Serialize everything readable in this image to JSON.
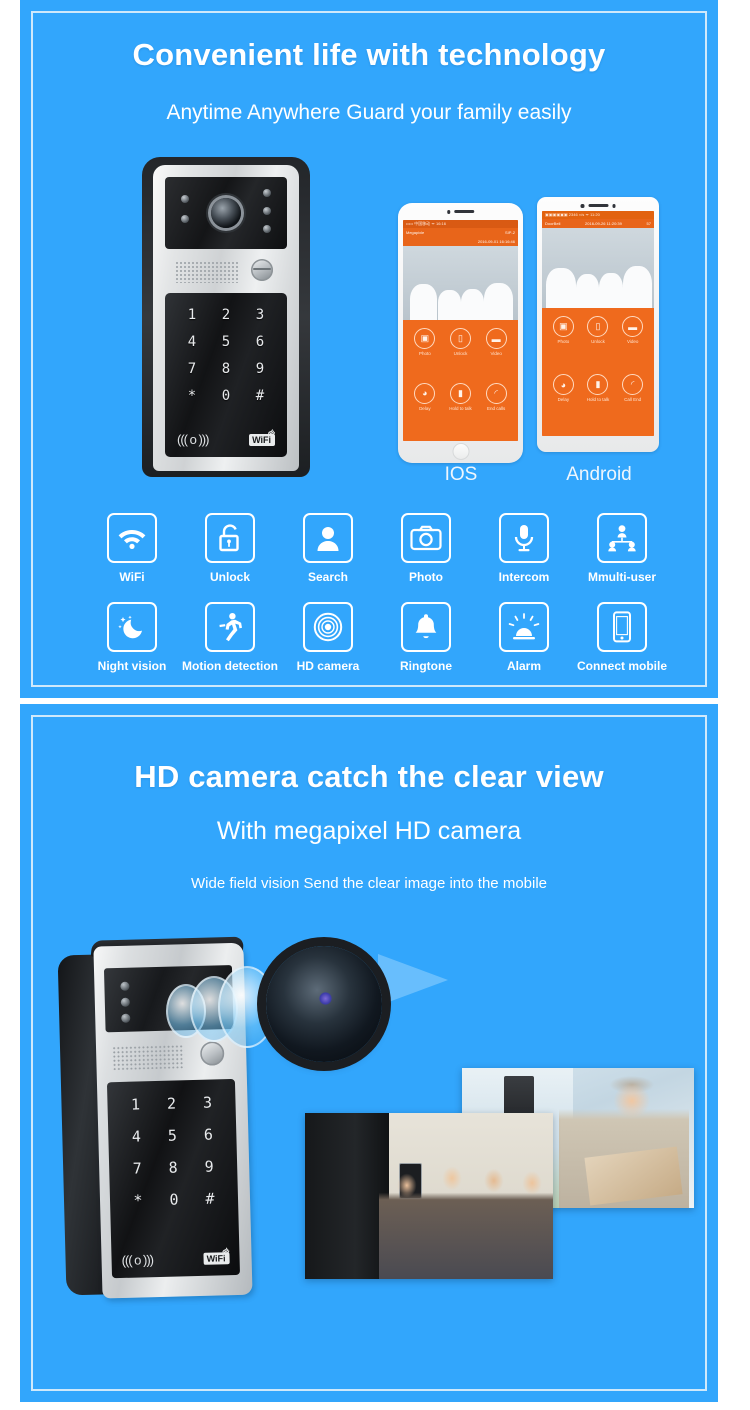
{
  "theme": {
    "background_blue": "#32a6fc",
    "inner_border": "#cfe9fb",
    "text_white": "#ffffff",
    "app_orange": "#ef6a1d"
  },
  "panel_one": {
    "title": "Convenient life with technology",
    "subtitle": "Anytime Anywhere Guard your family easily",
    "doorbell": {
      "keys": [
        "1",
        "2",
        "3",
        "4",
        "5",
        "6",
        "7",
        "8",
        "9",
        "*",
        "0",
        "#"
      ],
      "rfid_icon": "((( o )))",
      "wifi_badge": "WiFi"
    },
    "phones": [
      {
        "os_label": "IOS",
        "status_bar": "••••• 中国移动 ᯤ        16:16",
        "title_bar_left": "Megapixle",
        "title_bar_right": "SIP-2",
        "title_bar_date": "2016-09-01 16:16:46",
        "controls": [
          {
            "label": "Photo",
            "icon": "camera-icon",
            "glyph": "▣"
          },
          {
            "label": "Unlock",
            "icon": "lock-icon",
            "glyph": "▯"
          },
          {
            "label": "Video",
            "icon": "video-icon",
            "glyph": "▬"
          },
          {
            "label": "Delay",
            "icon": "clock-icon",
            "glyph": "◕"
          },
          {
            "label": "Hold to talk",
            "icon": "microphone-icon",
            "glyph": "▮"
          },
          {
            "label": "End calls",
            "icon": "end-call-icon",
            "glyph": "◜"
          }
        ]
      },
      {
        "os_label": "Android",
        "status_bar": "▣▣▣▣▣▣   2346 ×/s ᯤ 11:20",
        "title_bar_left": "DoorBell",
        "title_bar_right": "57",
        "title_bar_date": "2016-09-26 11:20:39",
        "controls": [
          {
            "label": "Photo",
            "icon": "camera-icon",
            "glyph": "▣"
          },
          {
            "label": "Unlock",
            "icon": "lock-icon",
            "glyph": "▯"
          },
          {
            "label": "Video",
            "icon": "video-icon",
            "glyph": "▬"
          },
          {
            "label": "Delay",
            "icon": "clock-icon",
            "glyph": "◕"
          },
          {
            "label": "Hold to talk",
            "icon": "microphone-icon",
            "glyph": "▮"
          },
          {
            "label": "Call End",
            "icon": "end-call-icon",
            "glyph": "◜"
          }
        ]
      }
    ],
    "features": [
      {
        "label": "WiFi",
        "icon": "wifi-icon"
      },
      {
        "label": "Unlock",
        "icon": "open-padlock-icon"
      },
      {
        "label": "Search",
        "icon": "person-silhouette-icon"
      },
      {
        "label": "Photo",
        "icon": "camera-icon"
      },
      {
        "label": "Intercom",
        "icon": "microphone-icon"
      },
      {
        "label": "Mmulti-user",
        "icon": "multi-user-icon"
      },
      {
        "label": "Night vision",
        "icon": "moon-stars-icon"
      },
      {
        "label": "Motion detection",
        "icon": "running-person-icon"
      },
      {
        "label": "HD camera",
        "icon": "camera-lens-icon"
      },
      {
        "label": "Ringtone",
        "icon": "bell-icon"
      },
      {
        "label": "Alarm",
        "icon": "siren-icon"
      },
      {
        "label": "Connect mobile",
        "icon": "smartphone-icon"
      }
    ]
  },
  "panel_two": {
    "title": "HD camera catch the clear view",
    "subtitle": "With megapixel HD camera",
    "caption": "Wide field vision Send the clear image into the mobile",
    "doorbell": {
      "keys": [
        "1",
        "2",
        "3",
        "4",
        "5",
        "6",
        "7",
        "8",
        "9",
        "*",
        "0",
        "#"
      ],
      "rfid_icon": "((( o )))",
      "wifi_badge": "WiFi"
    },
    "photos": [
      {
        "name": "delivery-person-at-door"
      },
      {
        "name": "visitors-at-front-door"
      }
    ]
  }
}
